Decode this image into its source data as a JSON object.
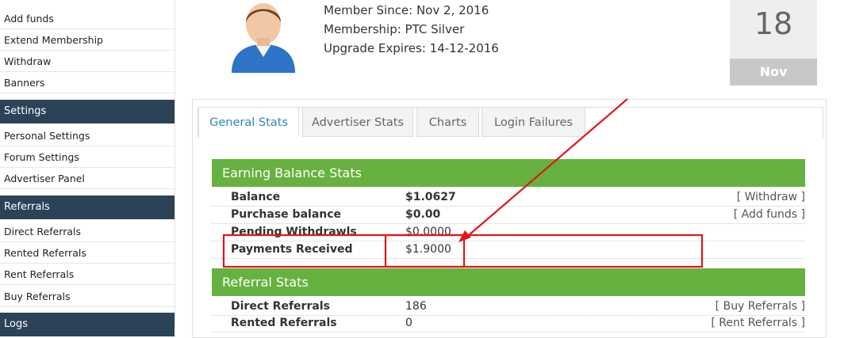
{
  "sidebar": {
    "items_top": [
      "Add funds",
      "Extend Membership",
      "Withdraw",
      "Banners"
    ],
    "settings_header": "Settings",
    "settings_items": [
      "Personal Settings",
      "Forum Settings",
      "Advertiser Panel"
    ],
    "referrals_header": "Referrals",
    "referrals_items": [
      "Direct Referrals",
      "Rented Referrals",
      "Rent Referrals",
      "Buy Referrals"
    ],
    "logs_header": "Logs"
  },
  "profile": {
    "member_since": "Member Since: Nov 2, 2016",
    "membership": "Membership: PTC Silver",
    "upgrade_expires": "Upgrade Expires: 14-12-2016"
  },
  "date": {
    "day": "18",
    "month": "Nov"
  },
  "tabs": [
    "General Stats",
    "Advertiser Stats",
    "Charts",
    "Login Failures"
  ],
  "earning": {
    "title": "Earning Balance Stats",
    "rows": [
      {
        "label": "Balance",
        "value": "$1.0627",
        "link": "[ Withdraw ]"
      },
      {
        "label": "Purchase balance",
        "value": "$0.00",
        "link": "[ Add funds ]"
      },
      {
        "label": "Pending Withdrawls",
        "value": "$0.0000",
        "link": ""
      },
      {
        "label": "Payments Received",
        "value": "$1.9000",
        "link": ""
      }
    ]
  },
  "referral": {
    "title": "Referral Stats",
    "rows": [
      {
        "label": "Direct Referrals",
        "value": "186",
        "link": "[ Buy Referrals ]"
      },
      {
        "label": "Rented Referrals",
        "value": "0",
        "link": "[ Rent Referrals ]"
      }
    ]
  },
  "colors": {
    "accent_green": "#66b13f",
    "sidebar_header": "#2c4257",
    "annotation_red": "#e0161b",
    "tab_active_text": "#2a8ab8"
  }
}
